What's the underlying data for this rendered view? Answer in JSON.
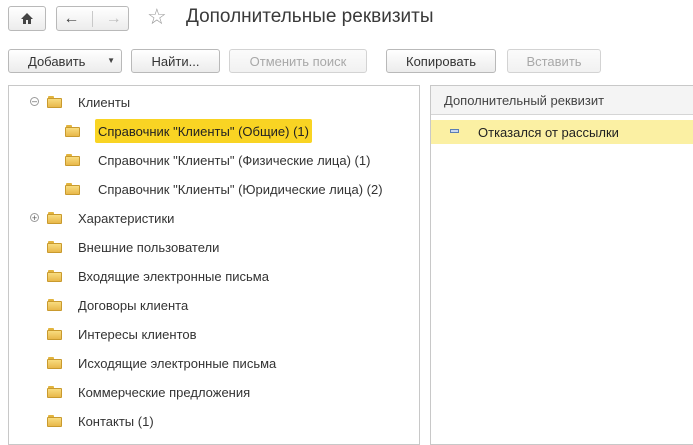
{
  "window": {
    "title": "Дополнительные реквизиты"
  },
  "toolbar": {
    "add_label": "Добавить",
    "find_label": "Найти...",
    "cancel_search_label": "Отменить поиск",
    "copy_label": "Копировать",
    "paste_label": "Вставить"
  },
  "tree": {
    "items": [
      {
        "label": "Клиенты"
      },
      {
        "label": "Справочник \"Клиенты\" (Общие) (1)"
      },
      {
        "label": "Справочник \"Клиенты\" (Физические лица) (1)"
      },
      {
        "label": "Справочник \"Клиенты\" (Юридические лица) (2)"
      },
      {
        "label": "Характеристики"
      },
      {
        "label": "Внешние пользователи"
      },
      {
        "label": "Входящие электронные письма"
      },
      {
        "label": "Договоры клиента"
      },
      {
        "label": "Интересы клиентов"
      },
      {
        "label": "Исходящие электронные письма"
      },
      {
        "label": "Коммерческие предложения"
      },
      {
        "label": "Контакты (1)"
      }
    ]
  },
  "grid": {
    "column_header": "Дополнительный реквизит",
    "rows": [
      {
        "value": "Отказался от рассылки"
      }
    ]
  },
  "colors": {
    "selection": "#f9d423",
    "row_highlight": "#fbf0a3"
  }
}
